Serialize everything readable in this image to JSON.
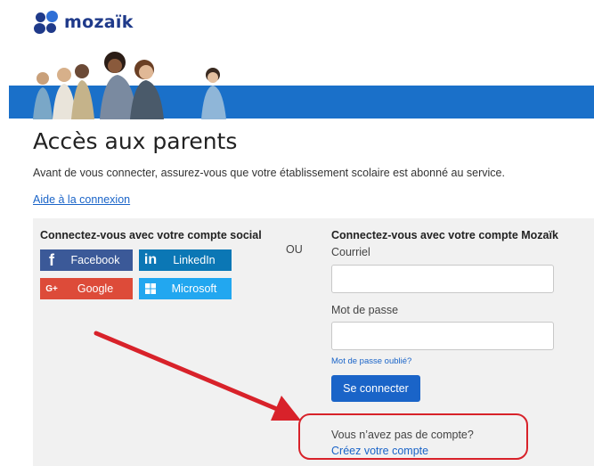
{
  "brand": {
    "name": "mozaïk"
  },
  "page": {
    "title": "Accès aux parents",
    "intro": "Avant de vous connecter, assurez-vous que votre établissement scolaire est abonné au service.",
    "help_link": "Aide à la connexion"
  },
  "social": {
    "heading": "Connectez-vous avec votre compte social",
    "buttons": [
      {
        "label": "Facebook",
        "icon": "f",
        "color": "#3b5998"
      },
      {
        "label": "LinkedIn",
        "icon": "in",
        "color": "#0b77b5"
      },
      {
        "label": "Google",
        "icon": "G+",
        "color": "#dd4b39"
      },
      {
        "label": "Microsoft",
        "icon": "windows-icon",
        "color": "#22a7f0"
      }
    ]
  },
  "separator": "OU",
  "mozaik_login": {
    "heading": "Connectez-vous avec votre compte Mozaïk",
    "email_label": "Courriel",
    "email_value": "",
    "password_label": "Mot de passe",
    "password_value": "",
    "forgot_password": "Mot de passe oublié?",
    "submit_label": "Se connecter"
  },
  "signup": {
    "prompt": "Vous n’avez pas de compte?",
    "link": "Créez votre compte"
  },
  "colors": {
    "brand_blue": "#1a70c9",
    "link_blue": "#1a64c8",
    "annotation_red": "#d8222a"
  }
}
